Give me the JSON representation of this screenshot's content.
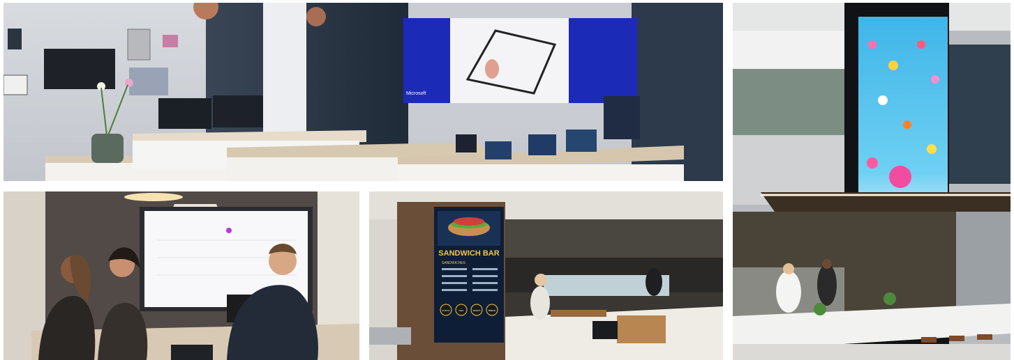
{
  "photos": [
    {
      "id": "showroom-devices"
    },
    {
      "id": "atrium-video-wall"
    },
    {
      "id": "meeting-room-whiteboard"
    },
    {
      "id": "sandwich-bar-canteen"
    }
  ],
  "texts": {
    "brand_label": "Microsoft",
    "menu_title": "SANDWICH BAR",
    "menu_section": "SANDWICHES",
    "menu_items": [
      "RUSTIC",
      "DELI",
      "WRAPS",
      "BREAD"
    ]
  }
}
